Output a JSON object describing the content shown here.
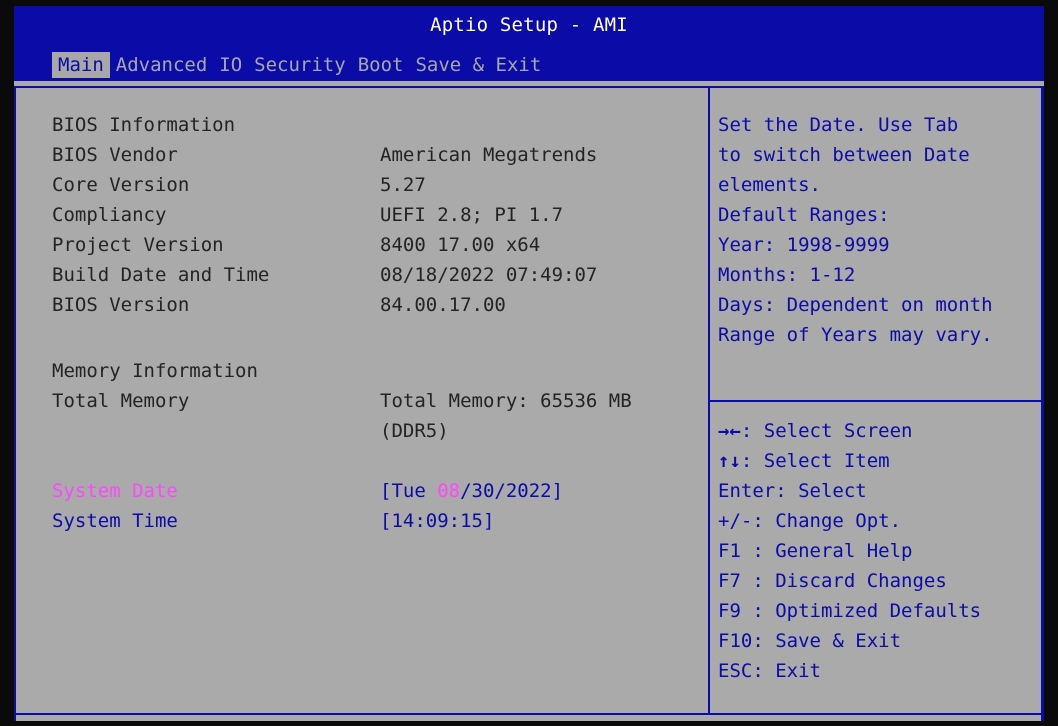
{
  "header": {
    "title": "Aptio Setup - AMI",
    "tabs": [
      {
        "label": "Main",
        "active": true
      },
      {
        "label": "Advanced",
        "active": false
      },
      {
        "label": "IO",
        "active": false
      },
      {
        "label": "Security",
        "active": false
      },
      {
        "label": "Boot",
        "active": false
      },
      {
        "label": "Save & Exit",
        "active": false
      }
    ]
  },
  "main": {
    "bios_info": {
      "heading": "BIOS Information",
      "rows": [
        {
          "label": "BIOS Vendor",
          "value": "American Megatrends"
        },
        {
          "label": "Core Version",
          "value": "5.27"
        },
        {
          "label": "Compliancy",
          "value": "UEFI 2.8; PI 1.7"
        },
        {
          "label": "Project Version",
          "value": "8400 17.00 x64"
        },
        {
          "label": "Build Date and Time",
          "value": "08/18/2022 07:49:07"
        },
        {
          "label": "BIOS Version",
          "value": "84.00.17.00"
        }
      ]
    },
    "memory_info": {
      "heading": "Memory Information",
      "total_label": "Total Memory",
      "total_value_line1": "Total Memory: 65536 MB",
      "total_value_line2": "(DDR5)"
    },
    "system_date": {
      "label": "System Date",
      "prefix": "[Tue ",
      "month": "08",
      "suffix": "/30/2022]"
    },
    "system_time": {
      "label": "System Time",
      "value": "[14:09:15]"
    }
  },
  "help": {
    "lines": [
      "Set the Date. Use Tab",
      "to switch between Date",
      "elements.",
      "Default Ranges:",
      "Year: 1998-9999",
      "Months: 1-12",
      "Days: Dependent on month",
      "Range of Years may vary."
    ]
  },
  "keys": [
    {
      "key": "→←",
      "desc": ": Select Screen"
    },
    {
      "key": "↑↓",
      "desc": ": Select Item"
    },
    {
      "key": "Enter",
      "desc": ": Select"
    },
    {
      "key": "+/-",
      "desc": ": Change Opt."
    },
    {
      "key": "F1 ",
      "desc": ": General Help"
    },
    {
      "key": "F7 ",
      "desc": ": Discard Changes"
    },
    {
      "key": "F9 ",
      "desc": ": Optimized Defaults"
    },
    {
      "key": "F10",
      "desc": ": Save & Exit"
    },
    {
      "key": "ESC",
      "desc": ": Exit"
    }
  ],
  "colors": {
    "title_bar": "#0b0ba8",
    "background": "#aaaaaa",
    "highlight": "#ff47ff",
    "text": "#232323"
  }
}
